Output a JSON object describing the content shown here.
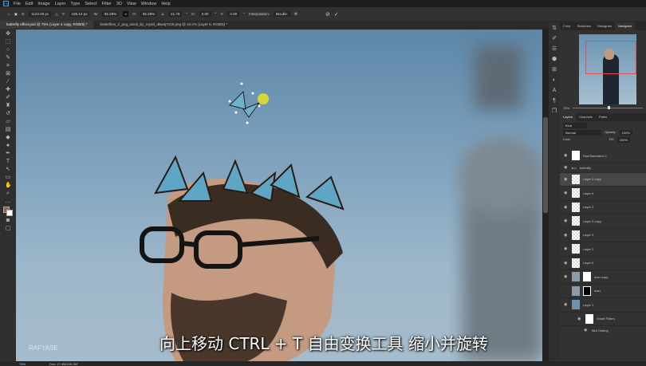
{
  "app": {
    "logo": "Ps"
  },
  "menu": [
    "File",
    "Edit",
    "Image",
    "Layer",
    "Type",
    "Select",
    "Filter",
    "3D",
    "View",
    "Window",
    "Help"
  ],
  "options": {
    "x": "1123.00 px",
    "y": "435.12 px",
    "w": "55.28%",
    "h": "55.28%",
    "angle": "21.76",
    "hskew": "0.00",
    "vskew": "0.00",
    "interpolation_label": "Interpolation:",
    "interpolation": "Bicubic"
  },
  "tabs": [
    {
      "label": "butterfly effect.psd @ 75% (Layer 4 copy, RGB/8) *"
    },
    {
      "label": "butterflies_2_png_stock_by_roy3d_d6w4j7n15.png @ 34.2% (Layer 6, RGB/8) *"
    }
  ],
  "navigator": {
    "tabs": [
      "Color",
      "Swatches",
      "Histogram",
      "Navigator"
    ],
    "zoom": "75%"
  },
  "layers_panel": {
    "tabs": [
      "Layers",
      "Channels",
      "Paths"
    ],
    "search": "Kind",
    "blend": "Normal",
    "opacity_label": "Opacity:",
    "opacity": "100%",
    "lock_label": "Lock:",
    "fill_label": "Fill:",
    "fill": "100%",
    "layers": [
      {
        "name": "Hue/Saturation 1"
      },
      {
        "name": "butterfly"
      },
      {
        "name": "Layer 4 copy",
        "selected": true
      },
      {
        "name": "Layer 4"
      },
      {
        "name": "Layer 3"
      },
      {
        "name": "Layer 3 copy"
      },
      {
        "name": "Layer 3"
      },
      {
        "name": "Layer 2"
      },
      {
        "name": "Layer 6"
      },
      {
        "name": "man copy"
      },
      {
        "name": "man"
      },
      {
        "name": "Layer 1"
      },
      {
        "name": "Smart Filters"
      },
      {
        "name": "Blur Gallery"
      }
    ]
  },
  "status": {
    "zoom": "75%",
    "doc": "Doc: 17.4M/149.3M"
  },
  "subtitle": "向上移动 CTRL + T 自由变换工具 缩小并旋转",
  "watermark": "RAFYASE"
}
